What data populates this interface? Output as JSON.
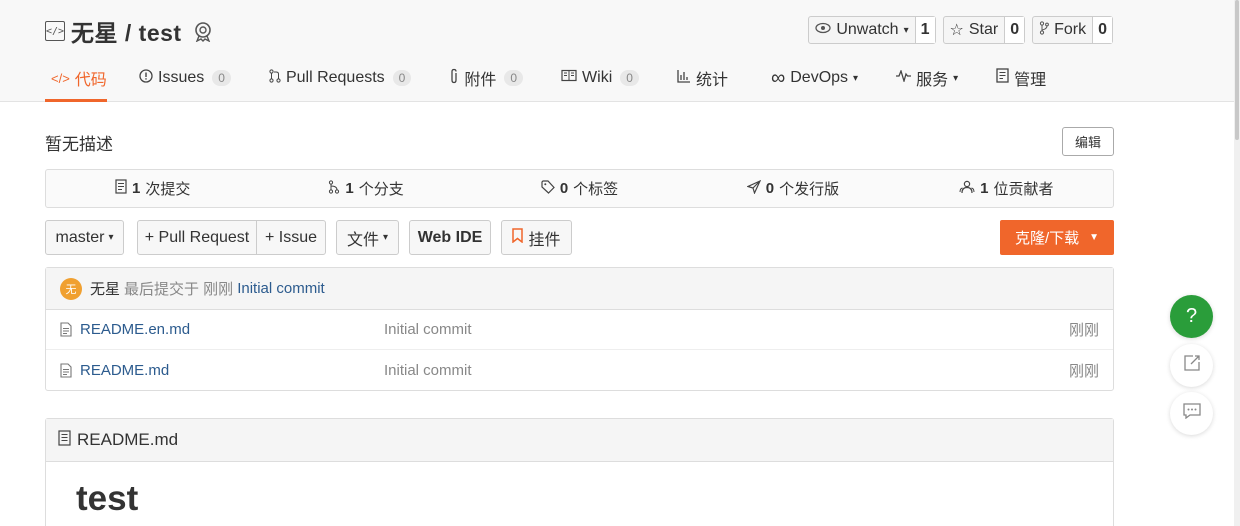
{
  "repo": {
    "owner": "无星",
    "sep": "/",
    "name": "test"
  },
  "actions": {
    "watch_label": "Unwatch",
    "watch_count": "1",
    "star_label": "Star",
    "star_count": "0",
    "fork_label": "Fork",
    "fork_count": "0"
  },
  "tabs": [
    {
      "label": "代码",
      "icon": "code-icon",
      "active": true
    },
    {
      "label": "Issues",
      "count": "0",
      "icon": "issue-icon"
    },
    {
      "label": "Pull Requests",
      "count": "0",
      "icon": "pull-request-icon"
    },
    {
      "label": "附件",
      "count": "0",
      "icon": "paperclip-icon"
    },
    {
      "label": "Wiki",
      "count": "0",
      "icon": "book-icon"
    },
    {
      "label": "统计",
      "icon": "bar-chart-icon"
    },
    {
      "label": "DevOps",
      "icon": "infinity-icon",
      "caret": true
    },
    {
      "label": "服务",
      "icon": "pulse-icon",
      "caret": true
    },
    {
      "label": "管理",
      "icon": "document-icon"
    }
  ],
  "description": "暂无描述",
  "edit_label": "编辑",
  "stats": [
    {
      "num": "1",
      "label": "次提交",
      "icon": "commit-icon"
    },
    {
      "num": "1",
      "label": "个分支",
      "icon": "branch-icon"
    },
    {
      "num": "0",
      "label": "个标签",
      "icon": "tag-icon"
    },
    {
      "num": "0",
      "label": "个发行版",
      "icon": "release-icon"
    },
    {
      "num": "1",
      "label": "位贡献者",
      "icon": "contributors-icon"
    }
  ],
  "toolbar": {
    "branch": "master",
    "pull_request": "+ Pull Request",
    "issue": "+ Issue",
    "file": "文件",
    "web_ide": "Web IDE",
    "widget": "挂件",
    "clone": "克隆/下载"
  },
  "last_commit": {
    "avatar_text": "无",
    "author": "无星",
    "meta": "最后提交于 刚刚",
    "message": "Initial commit"
  },
  "files": [
    {
      "name": "README.en.md",
      "commit": "Initial commit",
      "time": "刚刚"
    },
    {
      "name": "README.md",
      "commit": "Initial commit",
      "time": "刚刚"
    }
  ],
  "readme": {
    "filename": "README.md",
    "title": "test"
  },
  "floating": {
    "help": "?"
  },
  "colors": {
    "accent": "#f0662b",
    "link": "#2c5b8e",
    "help": "#2a9d3a"
  }
}
